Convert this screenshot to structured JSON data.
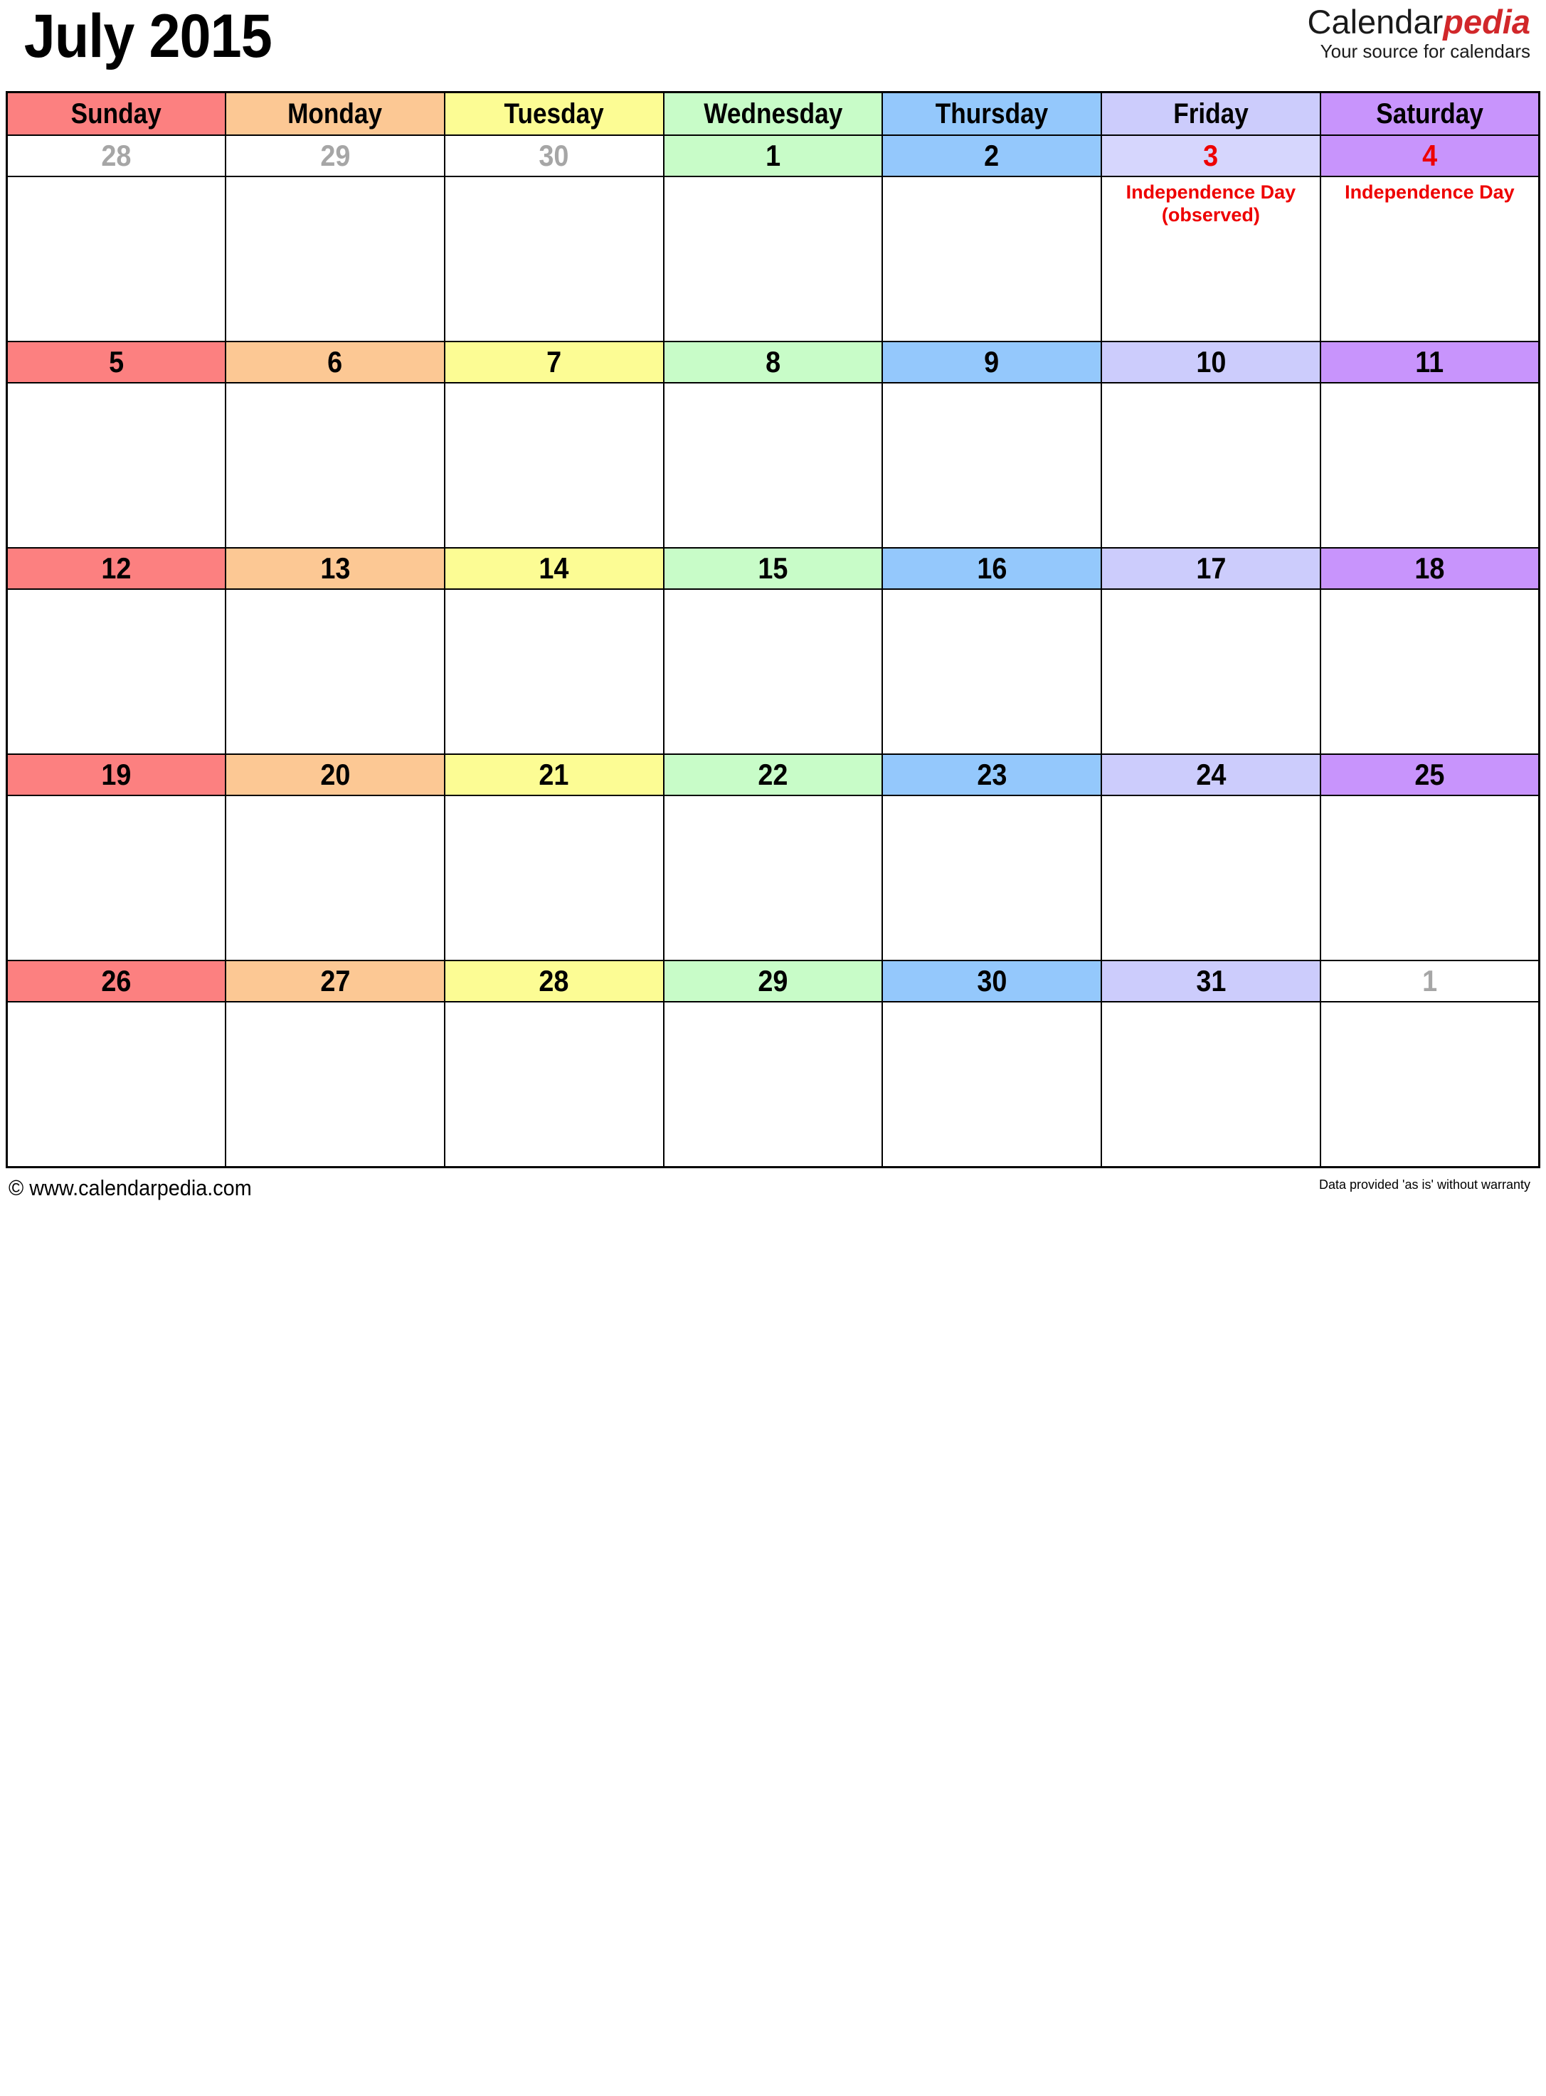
{
  "header": {
    "month_title": "July 2015",
    "brand_name_part1": "Calendar",
    "brand_name_part2": "pedia",
    "brand_tagline": "Your source for calendars"
  },
  "colors": {
    "sunday": "#fc8080",
    "monday": "#fcc894",
    "tuesday": "#fcfc94",
    "wednesday": "#c8fcc8",
    "thursday": "#94c8fc",
    "friday": "#ccccfc",
    "saturday": "#c894fc",
    "holiday_text": "#ee0000",
    "other_month_text": "#a6a6a6",
    "brand_accent": "#d1272a"
  },
  "weekdays": [
    {
      "label": "Sunday"
    },
    {
      "label": "Monday"
    },
    {
      "label": "Tuesday"
    },
    {
      "label": "Wednesday"
    },
    {
      "label": "Thursday"
    },
    {
      "label": "Friday"
    },
    {
      "label": "Saturday"
    }
  ],
  "weeks": [
    {
      "days": [
        {
          "date": "28",
          "other_month": true,
          "holiday": "",
          "note": ""
        },
        {
          "date": "29",
          "other_month": true,
          "holiday": "",
          "note": ""
        },
        {
          "date": "30",
          "other_month": true,
          "holiday": "",
          "note": ""
        },
        {
          "date": "1",
          "other_month": false,
          "holiday": "",
          "note": ""
        },
        {
          "date": "2",
          "other_month": false,
          "holiday": "",
          "note": ""
        },
        {
          "date": "3",
          "other_month": false,
          "holiday": "Independence Day (observed)",
          "note": ""
        },
        {
          "date": "4",
          "other_month": false,
          "holiday": "Independence Day",
          "note": ""
        }
      ]
    },
    {
      "days": [
        {
          "date": "5",
          "other_month": false,
          "holiday": "",
          "note": ""
        },
        {
          "date": "6",
          "other_month": false,
          "holiday": "",
          "note": ""
        },
        {
          "date": "7",
          "other_month": false,
          "holiday": "",
          "note": ""
        },
        {
          "date": "8",
          "other_month": false,
          "holiday": "",
          "note": ""
        },
        {
          "date": "9",
          "other_month": false,
          "holiday": "",
          "note": ""
        },
        {
          "date": "10",
          "other_month": false,
          "holiday": "",
          "note": ""
        },
        {
          "date": "11",
          "other_month": false,
          "holiday": "",
          "note": ""
        }
      ]
    },
    {
      "days": [
        {
          "date": "12",
          "other_month": false,
          "holiday": "",
          "note": ""
        },
        {
          "date": "13",
          "other_month": false,
          "holiday": "",
          "note": ""
        },
        {
          "date": "14",
          "other_month": false,
          "holiday": "",
          "note": ""
        },
        {
          "date": "15",
          "other_month": false,
          "holiday": "",
          "note": ""
        },
        {
          "date": "16",
          "other_month": false,
          "holiday": "",
          "note": ""
        },
        {
          "date": "17",
          "other_month": false,
          "holiday": "",
          "note": ""
        },
        {
          "date": "18",
          "other_month": false,
          "holiday": "",
          "note": ""
        }
      ]
    },
    {
      "days": [
        {
          "date": "19",
          "other_month": false,
          "holiday": "",
          "note": ""
        },
        {
          "date": "20",
          "other_month": false,
          "holiday": "",
          "note": ""
        },
        {
          "date": "21",
          "other_month": false,
          "holiday": "",
          "note": ""
        },
        {
          "date": "22",
          "other_month": false,
          "holiday": "",
          "note": ""
        },
        {
          "date": "23",
          "other_month": false,
          "holiday": "",
          "note": ""
        },
        {
          "date": "24",
          "other_month": false,
          "holiday": "",
          "note": ""
        },
        {
          "date": "25",
          "other_month": false,
          "holiday": "",
          "note": ""
        }
      ]
    },
    {
      "days": [
        {
          "date": "26",
          "other_month": false,
          "holiday": "",
          "note": ""
        },
        {
          "date": "27",
          "other_month": false,
          "holiday": "",
          "note": ""
        },
        {
          "date": "28",
          "other_month": false,
          "holiday": "",
          "note": ""
        },
        {
          "date": "29",
          "other_month": false,
          "holiday": "",
          "note": ""
        },
        {
          "date": "30",
          "other_month": false,
          "holiday": "",
          "note": ""
        },
        {
          "date": "31",
          "other_month": false,
          "holiday": "",
          "note": ""
        },
        {
          "date": "1",
          "other_month": true,
          "holiday": "",
          "note": ""
        }
      ]
    }
  ],
  "footer": {
    "copyright": "© www.calendarpedia.com",
    "disclaimer": "Data provided 'as is' without warranty"
  }
}
